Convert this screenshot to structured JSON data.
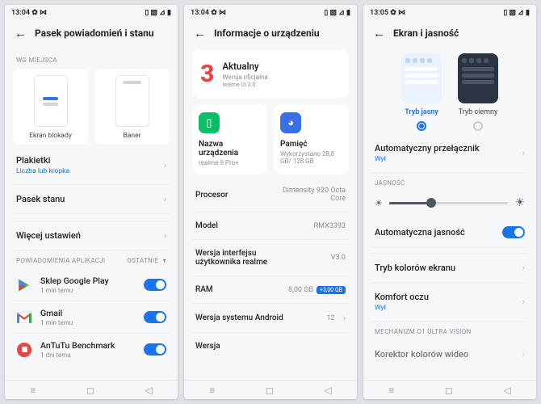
{
  "statusbar": {
    "time1": "13:04",
    "time2": "13:04",
    "time3": "13:05",
    "icons_left": "✿ ⋈",
    "icons_right": "▯ ▧ ⊿ ▮"
  },
  "s1": {
    "title": "Pasek powiadomień i stanu",
    "wg": "WG MIEJSCA",
    "card1": "Ekran blokady",
    "card2": "Baner",
    "plakietki": "Plakietki",
    "plakietki_sub": "Liczba lub kropka",
    "pasek": "Pasek stanu",
    "wiecej": "Więcej ustawień",
    "apps_label": "POWIADOMIENIA APLIKACJI",
    "ostatnie": "OSTATNIE",
    "apps": [
      {
        "name": "Sklep Google Play",
        "sub": "1 min temu"
      },
      {
        "name": "Gmail",
        "sub": "1 min temu"
      },
      {
        "name": "AnTuTu Benchmark",
        "sub": "1 dni temu"
      }
    ]
  },
  "s2": {
    "title": "Informacje o urządzeniu",
    "aktualny": "Aktualny",
    "aktualny_sub": "Wersja oficjalna",
    "realme_ui": "realme UI 3.0",
    "nazwa": "Nazwa urządzenia",
    "nazwa_sub": "realme 9 Pro+",
    "pamiec": "Pamięć",
    "pamiec_sub": "Wykorzystano 28,8 GB/ 128 GB",
    "procesor_l": "Procesor",
    "procesor_r": "Dimensity 920 Octa Core",
    "model_l": "Model",
    "model_r": "RMX3393",
    "wersjaui_l": "Wersja interfejsu użytkownika realme",
    "wersjaui_r": "V3.0",
    "ram_l": "RAM",
    "ram_r": "8,00 GB",
    "ram_badge": "+3,00 GB",
    "android_l": "Wersja systemu Android",
    "android_r": "12",
    "wersja_l": "Wersja"
  },
  "s3": {
    "title": "Ekran i jasność",
    "light": "Tryb jasny",
    "dark": "Tryb ciemny",
    "auto_switch": "Automatyczny przełącznik",
    "wyl": "Wył",
    "jasnosc": "JASNOŚĆ",
    "auto_bright": "Automatyczna jasność",
    "tryb_kolor": "Tryb kolorów ekranu",
    "komfort": "Komfort oczu",
    "mechanizm": "MECHANIZM O1 ULTRA VISION",
    "korektor": "Korektor kolorów wideo"
  }
}
